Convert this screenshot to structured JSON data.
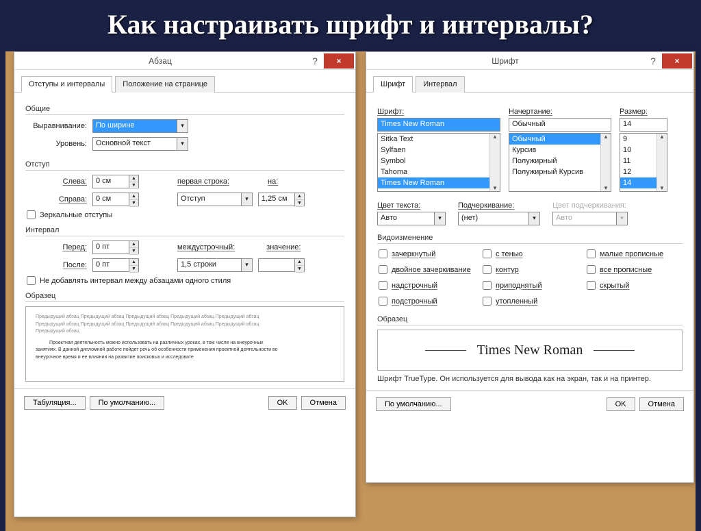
{
  "slide_title": "Как настраивать шрифт и интервалы?",
  "para": {
    "title": "Абзац",
    "tabs": [
      "Отступы и интервалы",
      "Положение на странице"
    ],
    "group_general": "Общие",
    "align_lbl": "Выравнивание:",
    "align_val": "По ширине",
    "level_lbl": "Уровень:",
    "level_val": "Основной текст",
    "group_indent": "Отступ",
    "left_lbl": "Слева:",
    "left_val": "0 см",
    "right_lbl": "Справа:",
    "right_val": "0 см",
    "firstline_lbl": "первая строка:",
    "firstline_val": "Отступ",
    "on_lbl": "на:",
    "on_val": "1,25 см",
    "mirror_chk": "Зеркальные отступы",
    "group_spacing": "Интервал",
    "before_lbl": "Перед:",
    "before_val": "0 пт",
    "after_lbl": "После:",
    "after_val": "0 пт",
    "line_lbl": "междустрочный:",
    "line_val": "1,5 строки",
    "value_lbl": "значение:",
    "value_val": "",
    "nospace_chk": "Не добавлять интервал между абзацами одного стиля",
    "group_sample": "Образец",
    "preview_l1": "Предыдущий абзац Предыдущий абзац Предыдущий абзац Предыдущий абзац Предыдущий абзац",
    "preview_l2": "Предыдущий абзац Предыдущий абзац Предыдущий абзац Предыдущий абзац Предыдущий абзац",
    "preview_l3": "Предыдущий абзац",
    "preview_m1": "Проектная деятельность можно использовать на различных уроках, в том числе на внеурочных",
    "preview_m2": "занятиях. В данной дипломной работе пойдет речь об особенности применения проектной деятельности во",
    "preview_m3": "внеурочное время и ее влиянии на развитие поисковых и исследовате",
    "btn_tabs": "Табуляция...",
    "btn_default": "По умолчанию...",
    "btn_ok": "OK",
    "btn_cancel": "Отмена"
  },
  "font": {
    "title": "Шрифт",
    "tabs": [
      "Шрифт",
      "Интервал"
    ],
    "font_lbl": "Шрифт:",
    "font_val": "Times New Roman",
    "font_list": [
      "Sitka Text",
      "Sylfaen",
      "Symbol",
      "Tahoma",
      "Times New Roman"
    ],
    "style_lbl": "Начертание:",
    "style_val": "Обычный",
    "style_list": [
      "Обычный",
      "Курсив",
      "Полужирный",
      "Полужирный Курсив"
    ],
    "size_lbl": "Размер:",
    "size_val": "14",
    "size_list": [
      "9",
      "10",
      "11",
      "12",
      "14"
    ],
    "color_lbl": "Цвет текста:",
    "color_val": "Авто",
    "underline_lbl": "Подчеркивание:",
    "underline_val": "(нет)",
    "ucolor_lbl": "Цвет подчеркивания:",
    "ucolor_val": "Авто",
    "group_mod": "Видоизменение",
    "mods": [
      "зачеркнутый",
      "с тенью",
      "малые прописные",
      "двойное зачеркивание",
      "контур",
      "все прописные",
      "надстрочный",
      "приподнятый",
      "скрытый",
      "подстрочный",
      "утопленный"
    ],
    "group_sample": "Образец",
    "sample_text": "Times New Roman",
    "footnote": "Шрифт TrueType. Он используется для вывода как на экран, так и на принтер.",
    "btn_default": "По умолчанию...",
    "btn_ok": "OK",
    "btn_cancel": "Отмена"
  }
}
